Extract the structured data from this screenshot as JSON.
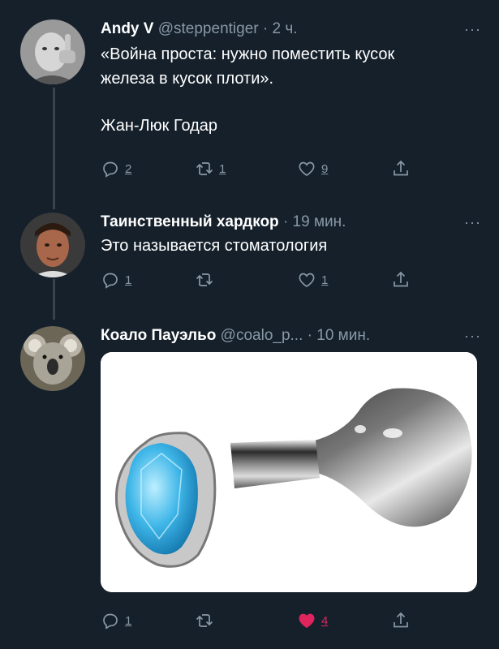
{
  "tweets": [
    {
      "name": "Andy V",
      "handle": "@steppentiger",
      "time": "· 2 ч.",
      "text_line1": "«Война проста: нужно поместить кусок",
      "text_line2": "железа в кусок плоти».",
      "text_line3": "Жан-Люк Годар",
      "replies": "2",
      "retweets": "1",
      "likes": "9"
    },
    {
      "name": "Таинственный хардкор",
      "handle": "",
      "time": "· 19 мин.",
      "text_line1": "Это называется стоматология",
      "replies": "1",
      "retweets": "",
      "likes": "1"
    },
    {
      "name": "Коало Пауэльо",
      "handle": "@coalo_p...",
      "time": "· 10 мин.",
      "replies": "1",
      "retweets": "",
      "likes": "4"
    }
  ],
  "more_label": "···",
  "colors": {
    "background": "#15202b",
    "secondary_text": "#8899a6",
    "like_active": "#e0245e",
    "thread_line": "#38444d"
  },
  "icons": [
    "reply-icon",
    "retweet-icon",
    "like-icon",
    "share-icon",
    "more-icon"
  ]
}
